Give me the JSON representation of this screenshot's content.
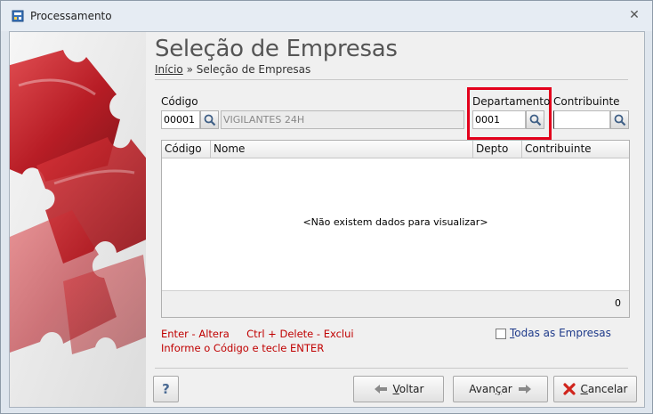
{
  "window": {
    "title": "Processamento",
    "close_glyph": "✕"
  },
  "page": {
    "heading": "Seleção de Empresas",
    "breadcrumb_home": "Início",
    "breadcrumb_separator": "»",
    "breadcrumb_current": "Seleção de Empresas"
  },
  "form": {
    "codigo_label": "Código",
    "codigo_value": "00001",
    "empresa_name": "VIGILANTES 24H",
    "departamento_label": "Departamento",
    "departamento_value": "0001",
    "contribuinte_label": "Contribuinte",
    "contribuinte_value": ""
  },
  "grid": {
    "columns": [
      "Código",
      "Nome",
      "Depto",
      "Contribuinte"
    ],
    "rows": [],
    "empty_message": "<Não existem dados para visualizar>",
    "count": "0"
  },
  "hints": {
    "line1_part1": "Enter - Altera",
    "line1_part2": "Ctrl + Delete - Exclui",
    "line2": "Informe o Código e tecle ENTER"
  },
  "options": {
    "todas_prefix": "T",
    "todas_rest": "odas as Empresas",
    "todas_checked": false
  },
  "buttons": {
    "help_label": "?",
    "voltar_prefix": "",
    "voltar_underline": "V",
    "voltar_rest": "oltar",
    "avancar_prefix": "Avan",
    "avancar_underline": "ç",
    "avancar_rest": "ar",
    "cancelar_prefix": "",
    "cancelar_underline": "C",
    "cancelar_rest": "ancelar"
  },
  "colors": {
    "highlight": "#e3001b",
    "hint_text": "#c00000",
    "puzzle_red": "#c81e24"
  },
  "icons": {
    "title": "app-icon",
    "search": "magnifier-icon",
    "back": "arrow-left-icon",
    "forward": "arrow-right-icon",
    "cancel": "red-x-icon",
    "help": "question-icon"
  }
}
